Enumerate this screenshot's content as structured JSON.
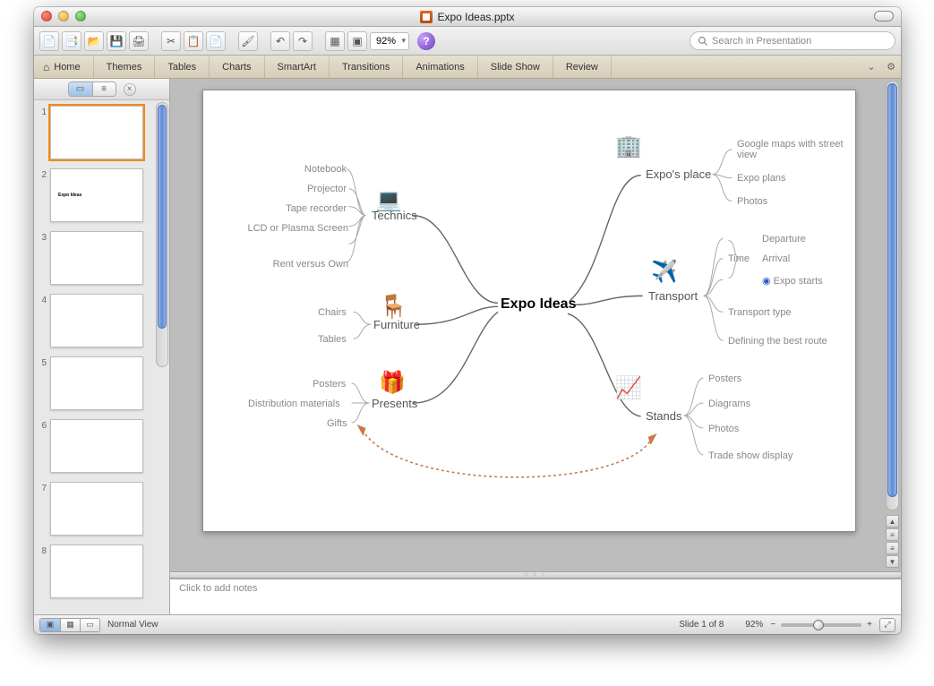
{
  "titlebar": {
    "filename": "Expo Ideas.pptx"
  },
  "toolbar": {
    "zoom": "92%",
    "search_placeholder": "Search in Presentation"
  },
  "ribbon": {
    "tabs": [
      "Home",
      "Themes",
      "Tables",
      "Charts",
      "SmartArt",
      "Transitions",
      "Animations",
      "Slide Show",
      "Review"
    ]
  },
  "sidebar": {
    "slides": [
      1,
      2,
      3,
      4,
      5,
      6,
      7,
      8
    ]
  },
  "notes": {
    "placeholder": "Click to add notes"
  },
  "status": {
    "view": "Normal View",
    "slide_indicator": "Slide 1 of 8",
    "zoom": "92%"
  },
  "mindmap": {
    "center": "Expo Ideas",
    "branches": {
      "technics": {
        "label": "Technics",
        "items": [
          "Notebook",
          "Projector",
          "Tape recorder",
          "LCD or Plasma Screen",
          "Rent versus Own"
        ]
      },
      "furniture": {
        "label": "Furniture",
        "items": [
          "Chairs",
          "Tables"
        ]
      },
      "presents": {
        "label": "Presents",
        "items": [
          "Posters",
          "Distribution materials",
          "Gifts"
        ]
      },
      "expo": {
        "label": "Expo's place",
        "items": [
          "Google maps with street view",
          "Expo plans",
          "Photos"
        ]
      },
      "transport": {
        "label": "Transport",
        "items": [
          "Departure",
          "Arrival",
          "Expo starts",
          "Transport type",
          "Defining the best route"
        ],
        "group": "Time"
      },
      "stands": {
        "label": "Stands",
        "items": [
          "Posters",
          "Diagrams",
          "Photos",
          "Trade show display"
        ]
      }
    }
  }
}
